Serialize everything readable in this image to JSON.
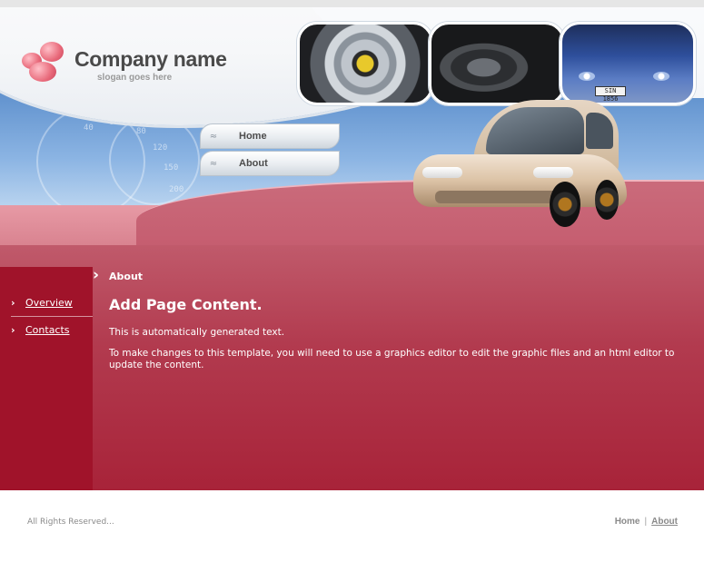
{
  "header": {
    "company_name": "Company name",
    "slogan": "slogan goes here",
    "plate_text": "SIN 1856",
    "nav": [
      {
        "label": "Home"
      },
      {
        "label": "About"
      }
    ]
  },
  "sidebar": {
    "items": [
      {
        "label": "Overview"
      },
      {
        "label": "Contacts"
      }
    ]
  },
  "content": {
    "section_title": "About",
    "heading": "Add Page Content.",
    "paragraph1": "This is automatically generated text.",
    "paragraph2": "To make changes to this template, you will need to use a graphics editor to edit the graphic files and an html editor to update the content."
  },
  "footer": {
    "copyright": "All Rights Reserved...",
    "links": [
      {
        "label": "Home"
      },
      {
        "label": "About"
      }
    ]
  },
  "colors": {
    "brand_red": "#a0132a",
    "header_blue": "#5d8fcc",
    "logo_pink": "#e8697a"
  },
  "icons": {
    "nav_pill": "double-chevron-icon",
    "sidebar_bullet": "chevron-right-icon",
    "section_marker": "chevron-right-icon"
  }
}
